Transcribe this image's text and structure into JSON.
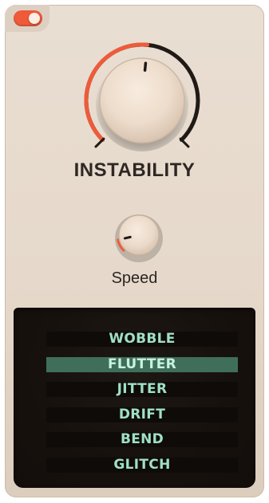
{
  "plugin": {
    "enabled": true,
    "accent_color": "#ef5b3a",
    "main_knob": {
      "label": "INSTABILITY",
      "value_fraction": 0.52
    },
    "speed_knob": {
      "label": "Speed",
      "value_fraction": 0.12
    },
    "modes": {
      "items": [
        "WOBBLE",
        "FLUTTER",
        "JITTER",
        "DRIFT",
        "BEND",
        "GLITCH"
      ],
      "selected": "FLUTTER",
      "text_color": "#9fe0c6",
      "selected_bg": "#3f6f5b"
    }
  }
}
